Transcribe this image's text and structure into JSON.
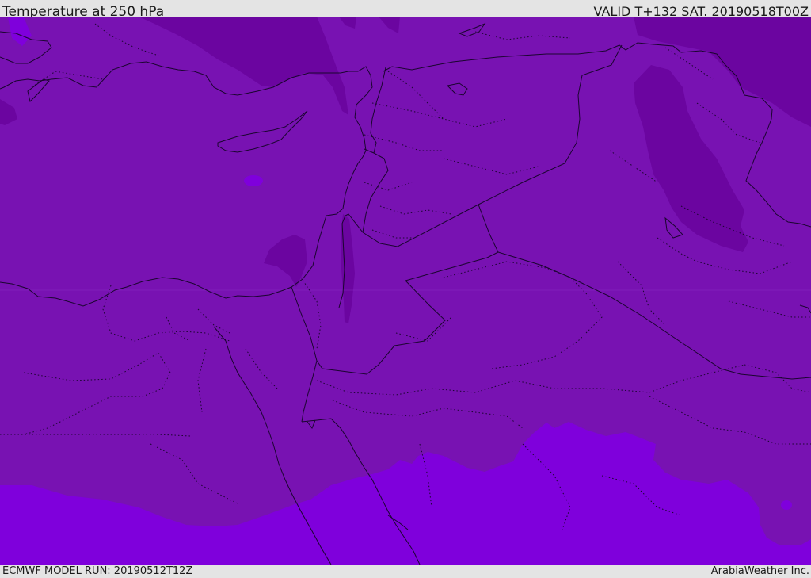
{
  "header": {
    "title": "Temperature at 250 hPa",
    "valid": "VALID T+132 SAT. 20190518T00Z"
  },
  "footer": {
    "model_run": "ECMWF MODEL RUN: 20190512T12Z",
    "credit": "ArabiaWeather Inc."
  },
  "map": {
    "colors": {
      "mid_band": "#7812b2",
      "cold_band": "#6b05a0",
      "warm_band": "#7f00dc",
      "coastline": "#1b0530",
      "border": "#1b0530"
    }
  }
}
